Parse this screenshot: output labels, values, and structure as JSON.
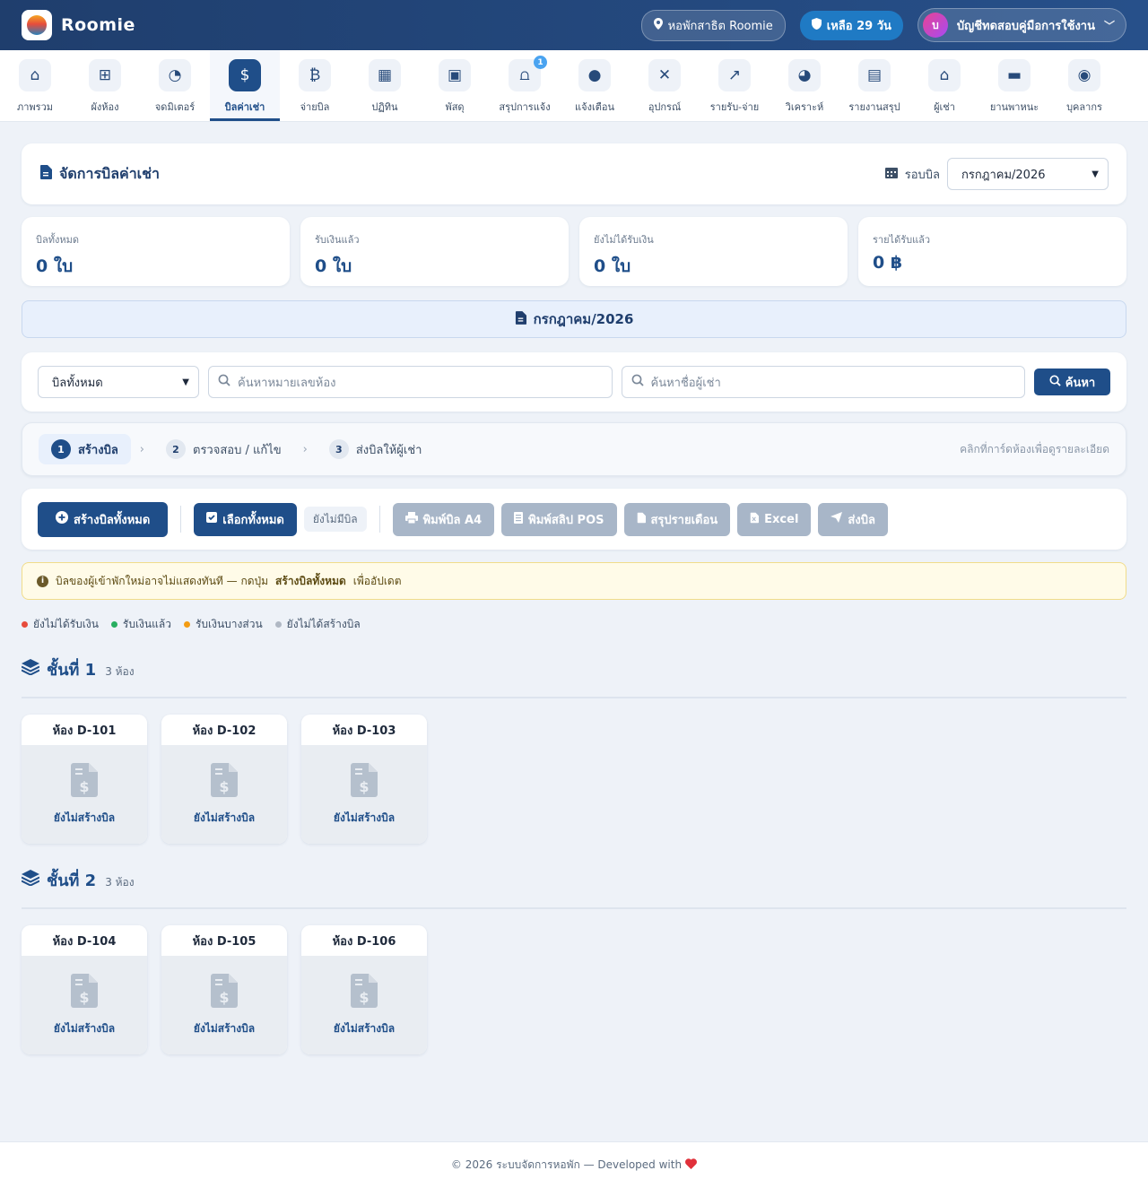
{
  "header": {
    "brand": "Roomie",
    "dorm_label": "หอพักสาธิต Roomie",
    "days_label": "เหลือ 29 วัน",
    "account_initial": "บ",
    "account_label": "บัญชีทดสอบคู่มือการใช้งาน"
  },
  "nav": {
    "items": [
      {
        "label": "ภาพรวม",
        "icon": "home-icon"
      },
      {
        "label": "ผังห้อง",
        "icon": "grid-icon"
      },
      {
        "label": "จดมิเตอร์",
        "icon": "gauge-icon"
      },
      {
        "label": "บิลค่าเช่า",
        "icon": "invoice-icon"
      },
      {
        "label": "จ่ายบิล",
        "icon": "money-icon"
      },
      {
        "label": "ปฏิทิน",
        "icon": "calendar-icon"
      },
      {
        "label": "พัสดุ",
        "icon": "boxes-icon"
      },
      {
        "label": "สรุปการแจ้ง",
        "icon": "bell-icon",
        "badge": "1"
      },
      {
        "label": "แจ้งเตือน",
        "icon": "chat-icon"
      },
      {
        "label": "อุปกรณ์",
        "icon": "tools-icon"
      },
      {
        "label": "รายรับ-จ่าย",
        "icon": "line-chart-icon"
      },
      {
        "label": "วิเคราะห์",
        "icon": "pie-chart-icon"
      },
      {
        "label": "รายงานสรุป",
        "icon": "report-icon"
      },
      {
        "label": "ผู้เช่า",
        "icon": "house-people-icon"
      },
      {
        "label": "ยานพาหนะ",
        "icon": "car-icon"
      },
      {
        "label": "บุคลากร",
        "icon": "person-icon"
      }
    ],
    "active_index": 3
  },
  "title": {
    "text": "จัดการบิลค่าเช่า",
    "cycle_label": "รอบบิล",
    "cycle_value": "กรกฎาคม/2026"
  },
  "stats": [
    {
      "label": "บิลทั้งหมด",
      "value": "0 ใบ"
    },
    {
      "label": "รับเงินแล้ว",
      "value": "0 ใบ"
    },
    {
      "label": "ยังไม่ได้รับเงิน",
      "value": "0 ใบ"
    },
    {
      "label": "รายได้รับแล้ว",
      "value": "0 ฿"
    }
  ],
  "month_banner": "กรกฎาคม/2026",
  "filter": {
    "status_value": "บิลทั้งหมด",
    "room_placeholder": "ค้นหาหมายเลขห้อง",
    "tenant_placeholder": "ค้นหาชื่อผู้เช่า",
    "search_label": "ค้นหา"
  },
  "steps": {
    "items": [
      {
        "num": "1",
        "label": "สร้างบิล"
      },
      {
        "num": "2",
        "label": "ตรวจสอบ / แก้ไข"
      },
      {
        "num": "3",
        "label": "ส่งบิลให้ผู้เช่า"
      }
    ],
    "hint": "คลิกที่การ์ดห้องเพื่อดูรายละเอียด"
  },
  "actions": {
    "create_all": "สร้างบิลทั้งหมด",
    "select_all": "เลือกทั้งหมด",
    "no_bill": "ยังไม่มีบิล",
    "print_a4": "พิมพ์บิล A4",
    "print_pos": "พิมพ์สลิป POS",
    "monthly_summary": "สรุปรายเดือน",
    "excel": "Excel",
    "send": "ส่งบิล"
  },
  "alert": {
    "prefix": "บิลของผู้เข้าพักใหม่อาจไม่แสดงทันที — กดปุ่ม",
    "bold": "สร้างบิลทั้งหมด",
    "suffix": "เพื่ออัปเดต"
  },
  "legend": [
    {
      "label": "ยังไม่ได้รับเงิน",
      "color": "#e74c3c"
    },
    {
      "label": "รับเงินแล้ว",
      "color": "#27ae60"
    },
    {
      "label": "รับเงินบางส่วน",
      "color": "#f39c12"
    },
    {
      "label": "ยังไม่ได้สร้างบิล",
      "color": "#b0b8c4"
    }
  ],
  "floors": [
    {
      "title": "ชั้นที่ 1",
      "count": "3 ห้อง",
      "rooms": [
        {
          "name": "ห้อง D-101",
          "status": "ยังไม่สร้างบิล"
        },
        {
          "name": "ห้อง D-102",
          "status": "ยังไม่สร้างบิล"
        },
        {
          "name": "ห้อง D-103",
          "status": "ยังไม่สร้างบิล"
        }
      ]
    },
    {
      "title": "ชั้นที่ 2",
      "count": "3 ห้อง",
      "rooms": [
        {
          "name": "ห้อง D-104",
          "status": "ยังไม่สร้างบิล"
        },
        {
          "name": "ห้อง D-105",
          "status": "ยังไม่สร้างบิล"
        },
        {
          "name": "ห้อง D-106",
          "status": "ยังไม่สร้างบิล"
        }
      ]
    }
  ],
  "footer": {
    "text": "© 2026 ระบบจัดการหอพัก — Developed with"
  }
}
